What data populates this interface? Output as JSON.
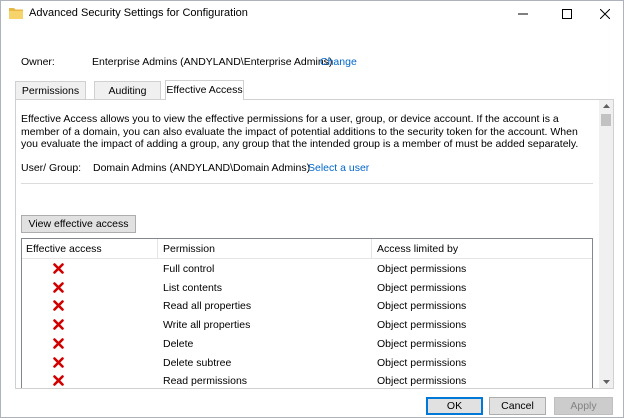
{
  "window": {
    "title": "Advanced Security Settings for Configuration",
    "icon": "folder-icon"
  },
  "owner": {
    "label": "Owner:",
    "value": "Enterprise Admins (ANDYLAND\\Enterprise Admins)",
    "change_link": "Change"
  },
  "tabs": [
    {
      "label": "Permissions",
      "selected": false
    },
    {
      "label": "Auditing",
      "selected": false
    },
    {
      "label": "Effective Access",
      "selected": true
    }
  ],
  "effective_access": {
    "description": "Effective Access allows you to view the effective permissions for a user, group, or device account. If the account is a member of a domain, you can also evaluate the impact of potential additions to the security token for the account. When you evaluate the impact of adding a group, any group that the intended group is a member of must be added separately.",
    "user_group_label": "User/ Group:",
    "user_group_value": "Domain Admins (ANDYLAND\\Domain Admins)",
    "select_user_link": "Select a user",
    "view_button": "View effective access"
  },
  "table": {
    "columns": [
      "Effective access",
      "Permission",
      "Access limited by"
    ],
    "rows": [
      {
        "access": "denied",
        "permission": "Full control",
        "limited_by": "Object permissions"
      },
      {
        "access": "denied",
        "permission": "List contents",
        "limited_by": "Object permissions"
      },
      {
        "access": "denied",
        "permission": "Read all properties",
        "limited_by": "Object permissions"
      },
      {
        "access": "denied",
        "permission": "Write all properties",
        "limited_by": "Object permissions"
      },
      {
        "access": "denied",
        "permission": "Delete",
        "limited_by": "Object permissions"
      },
      {
        "access": "denied",
        "permission": "Delete subtree",
        "limited_by": "Object permissions"
      },
      {
        "access": "denied",
        "permission": "Read permissions",
        "limited_by": "Object permissions"
      }
    ]
  },
  "buttons": {
    "ok": "OK",
    "cancel": "Cancel",
    "apply": "Apply"
  },
  "colors": {
    "link": "#0066cc",
    "deny_icon": "#d10000",
    "ok_border": "#0078d7"
  }
}
